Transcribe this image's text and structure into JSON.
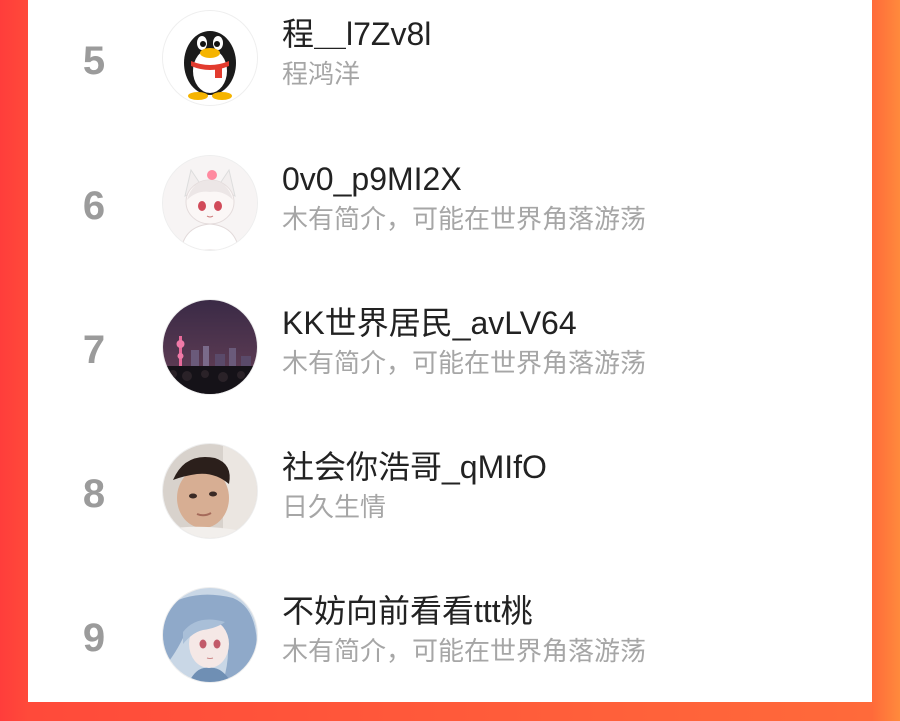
{
  "users": [
    {
      "rank": "5",
      "name": "程＿l7Zv8l",
      "bio": "程鸿洋",
      "avatar": "penguin-avatar-icon"
    },
    {
      "rank": "6",
      "name": "0v0_p9MI2X",
      "bio": "木有简介，可能在世界角落游荡",
      "avatar": "anime-cat-girl-avatar"
    },
    {
      "rank": "7",
      "name": "KK世界居民_avLV64",
      "bio": "木有简介，可能在世界角落游荡",
      "avatar": "city-night-skyline-avatar"
    },
    {
      "rank": "8",
      "name": "社会你浩哥_qMIfO",
      "bio": "日久生情",
      "avatar": "selfie-photo-avatar"
    },
    {
      "rank": "9",
      "name": "不妨向前看看ttt桃",
      "bio": "木有简介，可能在世界角落游荡",
      "avatar": "anime-blue-hair-avatar"
    }
  ],
  "colors": {
    "accent_left": "#ff3d3b",
    "accent_right": "#ff8a3c",
    "rank": "#9b9b9b",
    "name": "#222222",
    "bio": "#a6a6a6"
  }
}
